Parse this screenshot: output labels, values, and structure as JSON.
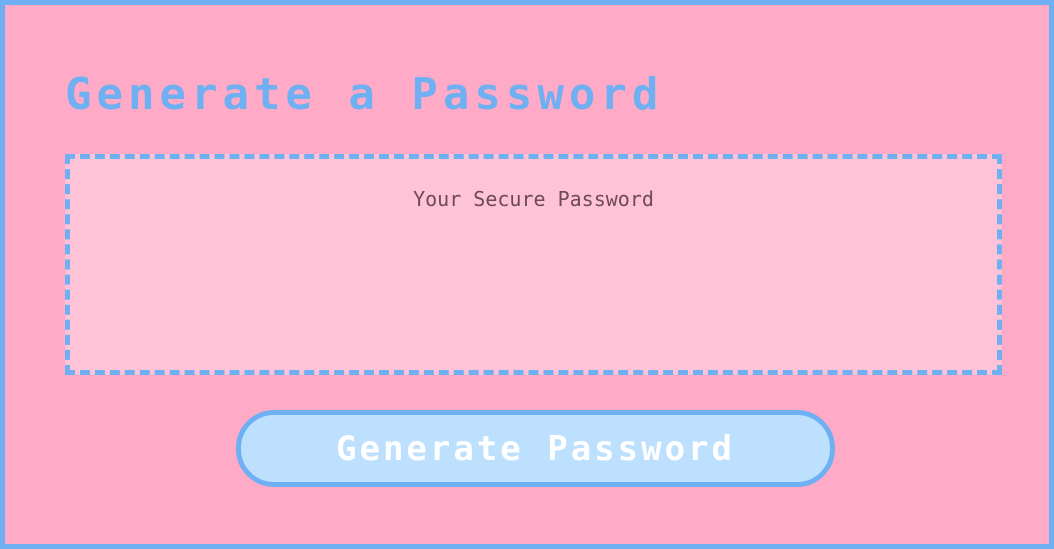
{
  "header": {
    "title": "Generate a Password"
  },
  "password_output": {
    "placeholder": "Your Secure Password",
    "value": ""
  },
  "actions": {
    "generate_label": "Generate Password"
  },
  "colors": {
    "background": "#ffaac6",
    "accent_blue": "#6fb0f2",
    "textarea_bg": "#ffc3d8",
    "button_bg": "#bde0fe",
    "button_text": "#ffffff"
  }
}
